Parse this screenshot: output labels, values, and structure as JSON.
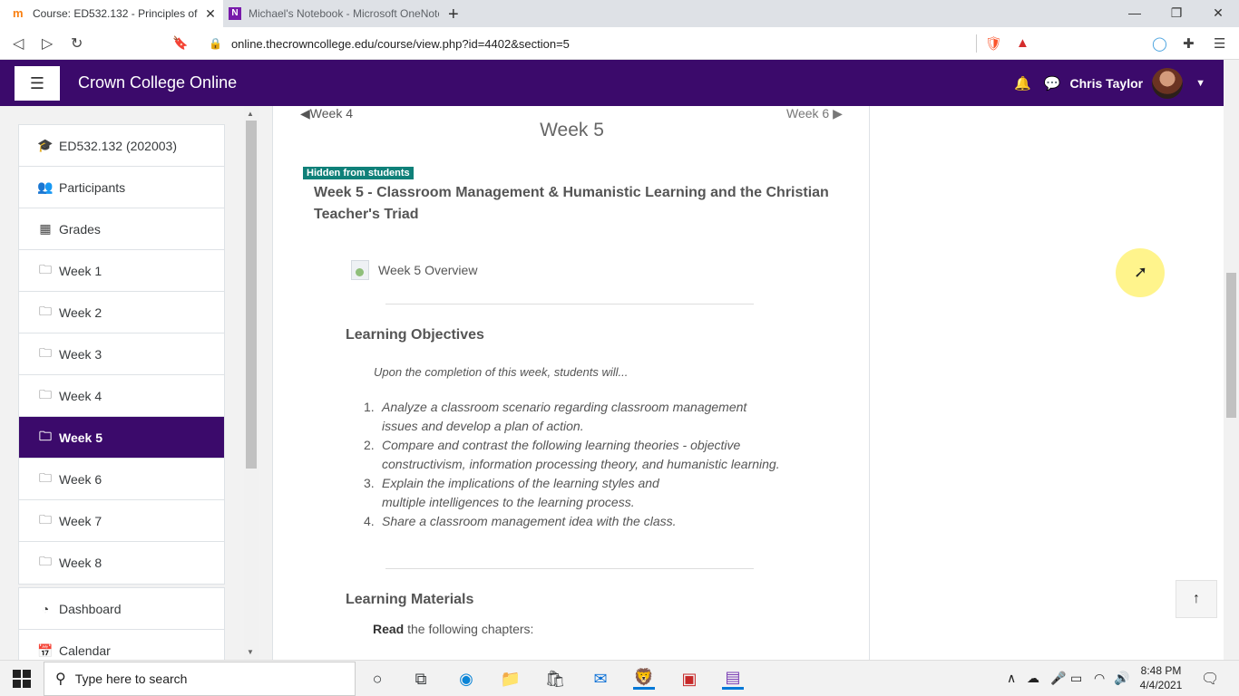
{
  "browser": {
    "tabs": [
      {
        "title": "Course: ED532.132 - Principles of",
        "active": true
      },
      {
        "title": "Michael's Notebook - Microsoft OneNote",
        "active": false
      }
    ],
    "url": "online.thecrowncollege.edu/course/view.php?id=4402&section=5"
  },
  "navbar": {
    "brand": "Crown College Online",
    "user_name": "Chris Taylor"
  },
  "sidebar": {
    "course_items": [
      {
        "icon": "graduation-cap-icon",
        "label": "ED532.132 (202003)"
      },
      {
        "icon": "users-icon",
        "label": "Participants"
      },
      {
        "icon": "table-icon",
        "label": "Grades"
      },
      {
        "icon": "folder-icon",
        "label": "Week 1"
      },
      {
        "icon": "folder-icon",
        "label": "Week 2"
      },
      {
        "icon": "folder-icon",
        "label": "Week 3"
      },
      {
        "icon": "folder-icon",
        "label": "Week 4"
      },
      {
        "icon": "folder-icon",
        "label": "Week 5",
        "active": true
      },
      {
        "icon": "folder-icon",
        "label": "Week 6"
      },
      {
        "icon": "folder-icon",
        "label": "Week 7"
      },
      {
        "icon": "folder-icon",
        "label": "Week 8"
      }
    ],
    "site_items": [
      {
        "icon": "dashboard-icon",
        "label": "Dashboard"
      },
      {
        "icon": "calendar-icon",
        "label": "Calendar"
      }
    ]
  },
  "main": {
    "prev_week": "Week 4",
    "next_week": "Week 6",
    "week_title": "Week 5",
    "hidden_badge": "Hidden from students",
    "section_name": "Week 5 - Classroom Management & Humanistic Learning and the Christian Teacher's Triad",
    "overview_link": "Week 5 Overview",
    "objectives_heading": "Learning Objectives",
    "objectives_intro": "Upon the completion of this week, students will...",
    "objectives": [
      "Analyze a classroom scenario regarding classroom management issues and develop a plan of action.",
      "Compare and contrast the following learning theories - objective constructivism, information processing theory, and humanistic learning.",
      "Explain the implications of the learning styles and multiple intelligences to the learning process.",
      "Share a classroom management idea with the class."
    ],
    "materials_heading": "Learning Materials",
    "read_bold": "Read",
    "read_rest": " the following chapters:"
  },
  "taskbar": {
    "search_placeholder": "Type here to search",
    "time": "8:48 PM",
    "date": "4/4/2021"
  },
  "colors": {
    "brand_purple": "#3b0a6b",
    "badge_teal": "#0f8079"
  }
}
